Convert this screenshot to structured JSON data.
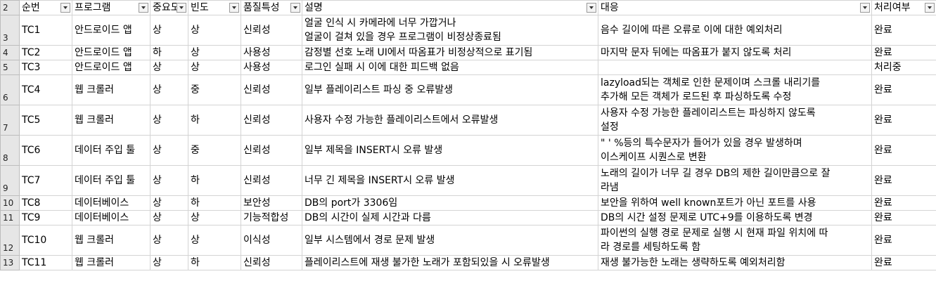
{
  "columns": [
    "순번",
    "프로그램",
    "중요도",
    "빈도",
    "품질특성",
    "설명",
    "대응",
    "처리여부"
  ],
  "header_row_number": "2",
  "rows": [
    {
      "rn": "3",
      "id": "TC1",
      "program": "안드로이드 앱",
      "importance": "상",
      "frequency": "상",
      "quality": "신뢰성",
      "desc": [
        "얼굴 인식 시 카메라에 너무 가깝거나",
        "얼굴이 걸쳐 있을 경우 프로그램이 비정상종료됨"
      ],
      "resp": [
        "음수 길이에 따른 오류로 이에 대한 예외처리"
      ],
      "status": "완료"
    },
    {
      "rn": "4",
      "id": "TC2",
      "program": "안드로이드 앱",
      "importance": "하",
      "frequency": "상",
      "quality": "사용성",
      "desc": [
        "감정별 선호 노래 UI에서 따옴표가 비정상적으로 표기됨"
      ],
      "resp": [
        "마지막 문자 뒤에는 따옴표가 붙지 않도록 처리"
      ],
      "status": "완료"
    },
    {
      "rn": "5",
      "id": "TC3",
      "program": "안드로이드 앱",
      "importance": "상",
      "frequency": "상",
      "quality": "사용성",
      "desc": [
        "로그인 실패 시 이에 대한 피드백 없음"
      ],
      "resp": [
        ""
      ],
      "status": "처리중"
    },
    {
      "rn": "6",
      "id": "TC4",
      "program": "웹 크롤러",
      "importance": "상",
      "frequency": "중",
      "quality": "신뢰성",
      "desc": [
        "일부 플레이리스트 파싱 중 오류발생"
      ],
      "resp": [
        "lazyload되는 객체로 인한 문제이며 스크롤 내리기를",
        "추가해 모든 객체가 로드된 후 파싱하도록 수정"
      ],
      "status": "완료"
    },
    {
      "rn": "7",
      "id": "TC5",
      "program": "웹 크롤러",
      "importance": "상",
      "frequency": "하",
      "quality": "신뢰성",
      "desc": [
        "사용자 수정 가능한 플레이리스트에서 오류발생"
      ],
      "resp": [
        "사용자 수정 가능한 플레이리스트는 파싱하지 않도록",
        "설정"
      ],
      "status": "완료"
    },
    {
      "rn": "8",
      "id": "TC6",
      "program": "데이터 주입 툴",
      "importance": "상",
      "frequency": "중",
      "quality": "신뢰성",
      "desc": [
        "일부 제목을 INSERT시 오류 발생"
      ],
      "resp": [
        "\" ' %등의 특수문자가 들어가 있을 경우 발생하며",
        "이스케이프 시퀀스로 변환"
      ],
      "status": "완료"
    },
    {
      "rn": "9",
      "id": "TC7",
      "program": "데이터 주입 툴",
      "importance": "상",
      "frequency": "하",
      "quality": "신뢰성",
      "desc": [
        "너무 긴 제목을 INSERT시 오류 발생"
      ],
      "resp": [
        "노래의 길이가 너무 길 경우 DB의 제한 길이만큼으로 잘",
        "라냄"
      ],
      "status": "완료"
    },
    {
      "rn": "10",
      "id": "TC8",
      "program": "데이터베이스",
      "importance": "상",
      "frequency": "하",
      "quality": "보안성",
      "desc": [
        "DB의 port가 3306임"
      ],
      "resp": [
        "보안을 위하여 well known포트가 아닌 포트를 사용"
      ],
      "status": "완료"
    },
    {
      "rn": "11",
      "id": "TC9",
      "program": "데이터베이스",
      "importance": "상",
      "frequency": "상",
      "quality": "기능적합성",
      "desc": [
        "DB의 시간이 실제 시간과 다름"
      ],
      "resp": [
        "DB의 시간 설정 문제로 UTC+9를 이용하도록 변경"
      ],
      "status": "완료"
    },
    {
      "rn": "12",
      "id": "TC10",
      "program": "웹 크롤러",
      "importance": "상",
      "frequency": "상",
      "quality": "이식성",
      "desc": [
        "일부 시스템에서 경로 문제 발생"
      ],
      "resp": [
        "파이썬의 실행 경로 문제로 실행 시 현재 파일 위치에 따",
        "라 경로를 세팅하도록 함"
      ],
      "status": "완료"
    },
    {
      "rn": "13",
      "id": "TC11",
      "program": "웹 크롤러",
      "importance": "상",
      "frequency": "하",
      "quality": "신뢰성",
      "desc": [
        "플레이리스트에 재생 불가한 노래가 포함되있을 시 오류발생"
      ],
      "resp": [
        "재생 불가능한 노래는 생략하도록 예외처리함"
      ],
      "status": "완료"
    }
  ]
}
